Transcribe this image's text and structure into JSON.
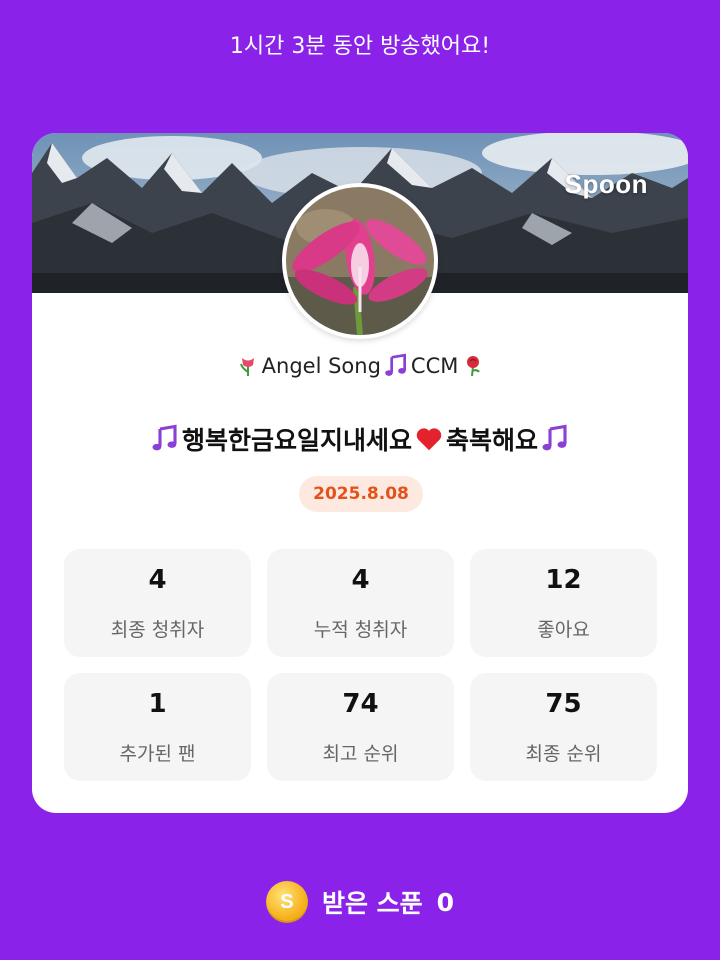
{
  "header": {
    "duration_text": "1시간 3분 동안 방송했어요!"
  },
  "card": {
    "brand": "Spoon",
    "host_name": "Angel Song",
    "host_suffix": "CCM",
    "title_text": "행복한금요일지내세요",
    "title_suffix": " 축복해요",
    "date": "2025.8.08"
  },
  "stats": [
    {
      "value": "4",
      "label": "최종 청취자"
    },
    {
      "value": "4",
      "label": "누적 청취자"
    },
    {
      "value": "12",
      "label": "좋아요"
    },
    {
      "value": "1",
      "label": "추가된 팬"
    },
    {
      "value": "74",
      "label": "최고 순위"
    },
    {
      "value": "75",
      "label": "최종 순위"
    }
  ],
  "footer": {
    "coin_symbol": "S",
    "spoon_label": "받은 스푼",
    "spoon_count": "0"
  },
  "colors": {
    "background": "#8a22ea",
    "date_text": "#e2531c",
    "date_bg": "#fde9e0"
  },
  "icons": [
    "tulip-icon",
    "music-note-icon",
    "rose-icon",
    "heart-icon",
    "coin-icon"
  ]
}
